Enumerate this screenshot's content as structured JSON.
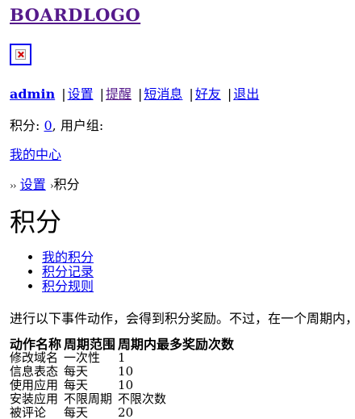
{
  "header": {
    "logo_text": "BOARDLOGO"
  },
  "usernav": {
    "username": "admin",
    "links": [
      "设置",
      "提醒",
      "短消息",
      "好友",
      "退出"
    ]
  },
  "credits": {
    "label": "积分: ",
    "value": "0",
    "group_label": ", 用户组:"
  },
  "my_center_link": "我的中心",
  "breadcrumb": {
    "leading_arrows": "››",
    "link": "设置",
    "separator": "›",
    "current": "积分"
  },
  "page_title": "积分",
  "subnav": [
    "我的积分",
    "积分记录",
    "积分规则"
  ],
  "intro_text": "进行以下事件动作，会得到积分奖励。不过，在一个周期内，",
  "rules_table": {
    "headers": [
      "动作名称",
      "周期范围",
      "周期内最多奖励次数"
    ],
    "rows": [
      [
        "修改域名",
        "一次性",
        "1"
      ],
      [
        "信息表态",
        "每天",
        "10"
      ],
      [
        "使用应用",
        "每天",
        "10"
      ],
      [
        "安装应用",
        "不限周期",
        "不限次数"
      ],
      [
        "被评论",
        "每天",
        "20"
      ]
    ]
  }
}
